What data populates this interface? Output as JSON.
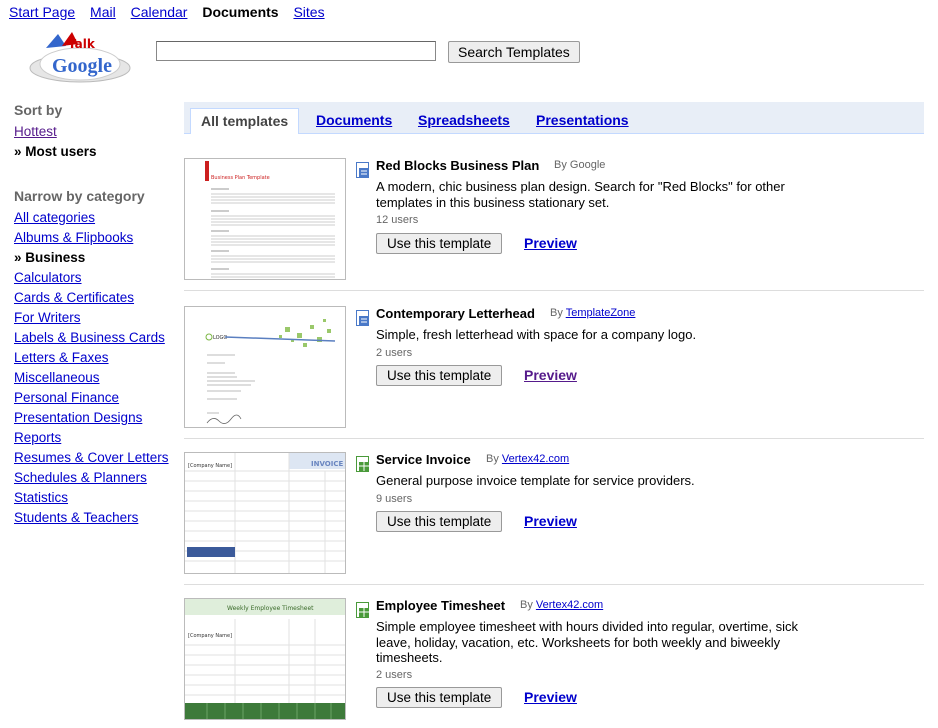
{
  "nav": {
    "items": [
      "Start Page",
      "Mail",
      "Calendar",
      "Documents",
      "Sites"
    ],
    "current": "Documents"
  },
  "logo": {
    "text": "Google",
    "sub": "Talk"
  },
  "search": {
    "value": "",
    "button": "Search Templates"
  },
  "sort": {
    "heading": "Sort by",
    "options": [
      "Hottest",
      "Most users"
    ],
    "active": "Most users",
    "active_prefix": "»  Most users"
  },
  "category": {
    "heading": "Narrow by category",
    "items": [
      "All categories",
      "Albums & Flipbooks",
      "»  Business",
      "Calculators",
      "Cards & Certificates",
      "For Writers",
      "Labels & Business Cards",
      "Letters & Faxes",
      "Miscellaneous",
      "Personal Finance",
      "Presentation Designs",
      "Reports",
      "Resumes & Cover Letters",
      "Schedules & Planners",
      "Statistics",
      "Students & Teachers"
    ]
  },
  "tabs": [
    "All templates",
    "Documents",
    "Spreadsheets",
    "Presentations"
  ],
  "templates": [
    {
      "title": "Red Blocks Business Plan",
      "by_prefix": "By",
      "author": "Google",
      "author_link": false,
      "description": "A modern, chic business plan design. Search for \"Red Blocks\" for other templates in this business stationary set.",
      "users": "12 users",
      "use_label": "Use this template",
      "preview_label": "Preview",
      "kind": "document",
      "thumb_title": "Business Plan Template"
    },
    {
      "title": "Contemporary Letterhead",
      "by_prefix": "By",
      "author": "TemplateZone",
      "author_link": true,
      "description": "Simple, fresh letterhead with space for a company logo.",
      "users": "2 users",
      "use_label": "Use this template",
      "preview_label": "Preview",
      "kind": "document",
      "thumb_title": "LOGO"
    },
    {
      "title": "Service Invoice",
      "by_prefix": "By",
      "author": "Vertex42.com",
      "author_link": true,
      "description": "General purpose invoice template for service providers.",
      "users": "9 users",
      "use_label": "Use this template",
      "preview_label": "Preview",
      "kind": "spreadsheet",
      "thumb_title": "INVOICE",
      "thumb_company": "[Company Name]"
    },
    {
      "title": "Employee Timesheet",
      "by_prefix": "By",
      "author": "Vertex42.com",
      "author_link": true,
      "description": "Simple employee timesheet with hours divided into regular, overtime, sick leave, holiday, vacation, etc. Worksheets for both weekly and biweekly timesheets.",
      "users": "2 users",
      "use_label": "Use this template",
      "preview_label": "Preview",
      "kind": "spreadsheet",
      "thumb_title": "Weekly Employee Timesheet",
      "thumb_company": "[Company Name]"
    }
  ]
}
